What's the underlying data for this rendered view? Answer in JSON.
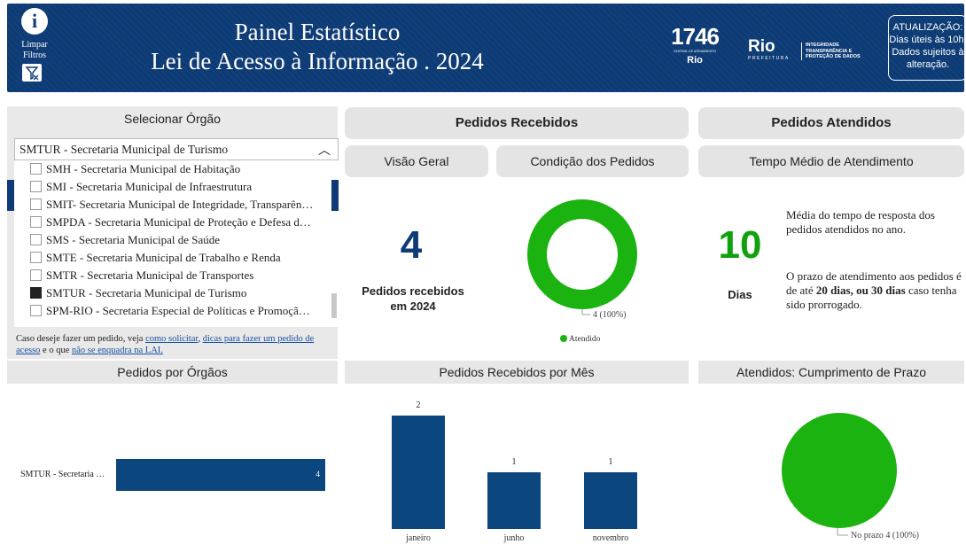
{
  "header": {
    "clear_filters": "Limpar Filtros",
    "title_line1": "Painel Estatístico",
    "title_line2": "Lei de Acesso à Informação . 2024",
    "logo_1746": "1746",
    "logo_1746_sub": "CENTRAL DE ATENDIMENTO",
    "logo_1746_rio": "Rio",
    "logo_rio": "Rio",
    "logo_rio_sub": "PREFEITURA",
    "logo_integ": [
      "INTEGRIDADE",
      "TRANSPARÊNCIA E",
      "PROTEÇÃO DE DADOS"
    ],
    "update": "ATUALIZAÇÃO: Dias úteis às 10h. Dados sujeitos à alteração."
  },
  "filter": {
    "title": "Selecionar Órgão",
    "selected": "SMTUR - Secretaria Municipal de Turismo",
    "options": [
      {
        "label": "SMH - Secretaria Municipal de Habitação",
        "checked": false
      },
      {
        "label": "SMI - Secretaria Municipal de Infraestrutura",
        "checked": false
      },
      {
        "label": "SMIT- Secretaria Municipal de Integridade, Transparên…",
        "checked": false
      },
      {
        "label": "SMPDA - Secretaria Municipal de Proteção e Defesa d…",
        "checked": false
      },
      {
        "label": "SMS - Secretaria Municipal de Saúde",
        "checked": false
      },
      {
        "label": "SMTE - Secretaria Municipal de Trabalho e Renda",
        "checked": false
      },
      {
        "label": "SMTR - Secretaria Municipal de Transportes",
        "checked": false
      },
      {
        "label": "SMTUR - Secretaria Municipal de Turismo",
        "checked": true
      },
      {
        "label": "SPM-RIO - Secretaria Especial de Políticas e Promoçã…",
        "checked": false
      }
    ],
    "help_prefix": "Caso deseje fazer um pedido, veja ",
    "link_how": "como solicitar",
    "link_tips": "dicas para fazer um pedido de acesso",
    "help_mid": " e o que ",
    "link_not": "não se enquadra na LAI."
  },
  "received": {
    "header": "Pedidos Recebidos",
    "tab_overview": "Visão Geral",
    "tab_condition": "Condição dos Pedidos",
    "count": "4",
    "count_label": "Pedidos recebidos em 2024",
    "donut_label": "4 (100%)",
    "legend": "Atendido"
  },
  "attended": {
    "header": "Pedidos Atendidos",
    "tab": "Tempo Médio de Atendimento",
    "days": "10",
    "days_label": "Dias",
    "desc1": "Média do tempo de resposta dos pedidos atendidos no ano.",
    "desc2_pre": "O prazo de atendimento aos pedidos é de até ",
    "desc2_bold": "20 dias, ou 30 dias",
    "desc2_post": " caso tenha sido prorrogado."
  },
  "bottom": {
    "by_org_title": "Pedidos por Órgãos",
    "by_month_title": "Pedidos Recebidos por Mês",
    "deadline_title": "Atendidos: Cumprimento de Prazo",
    "pie_label": "No prazo 4 (100%)"
  },
  "colors": {
    "navy": "#0d3b75",
    "bar": "#0b467e",
    "green": "#1bb30f"
  },
  "chart_data": [
    {
      "type": "pie",
      "subtype": "donut",
      "title": "Condição dos Pedidos",
      "categories": [
        "Atendido"
      ],
      "values": [
        4
      ],
      "data_labels": [
        "4 (100%)"
      ],
      "legend": [
        "Atendido"
      ],
      "legend_position": "bottom"
    },
    {
      "type": "bar",
      "orientation": "horizontal",
      "title": "Pedidos por Órgãos",
      "categories": [
        "SMTUR - Secretaria …"
      ],
      "values": [
        4
      ],
      "data_labels": [
        "4"
      ]
    },
    {
      "type": "bar",
      "title": "Pedidos Recebidos por Mês",
      "categories": [
        "janeiro",
        "junho",
        "novembro"
      ],
      "values": [
        2,
        1,
        1
      ],
      "data_labels": [
        "2",
        "1",
        "1"
      ]
    },
    {
      "type": "pie",
      "title": "Atendidos: Cumprimento de Prazo",
      "categories": [
        "No prazo"
      ],
      "values": [
        4
      ],
      "data_labels": [
        "No prazo 4 (100%)"
      ]
    }
  ]
}
